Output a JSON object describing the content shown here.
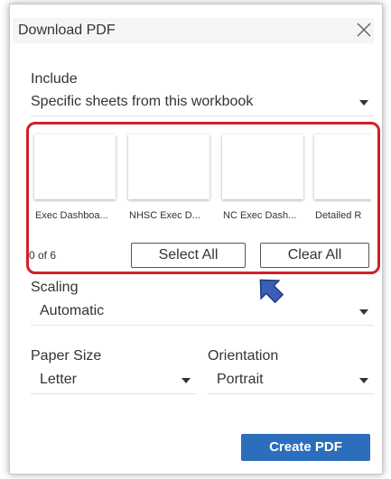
{
  "dialog": {
    "title": "Download PDF",
    "close_icon": "close-icon"
  },
  "include": {
    "label": "Include",
    "selected": "Specific sheets from this workbook"
  },
  "sheets": [
    {
      "caption": "Exec Dashboa..."
    },
    {
      "caption": "NHSC Exec D..."
    },
    {
      "caption": "NC Exec Dash..."
    },
    {
      "caption": "Detailed R"
    }
  ],
  "selection": {
    "count": "0 of 6",
    "select_all": "Select All",
    "clear_all": "Clear All"
  },
  "scaling": {
    "label": "Scaling",
    "selected": "Automatic"
  },
  "paper_size": {
    "label": "Paper Size",
    "selected": "Letter"
  },
  "orientation": {
    "label": "Orientation",
    "selected": "Portrait"
  },
  "create_pdf": "Create PDF",
  "colors": {
    "highlight": "#d0202a",
    "primary_button": "#2c6ebb",
    "annotation_arrow": "#3b5fb6"
  }
}
